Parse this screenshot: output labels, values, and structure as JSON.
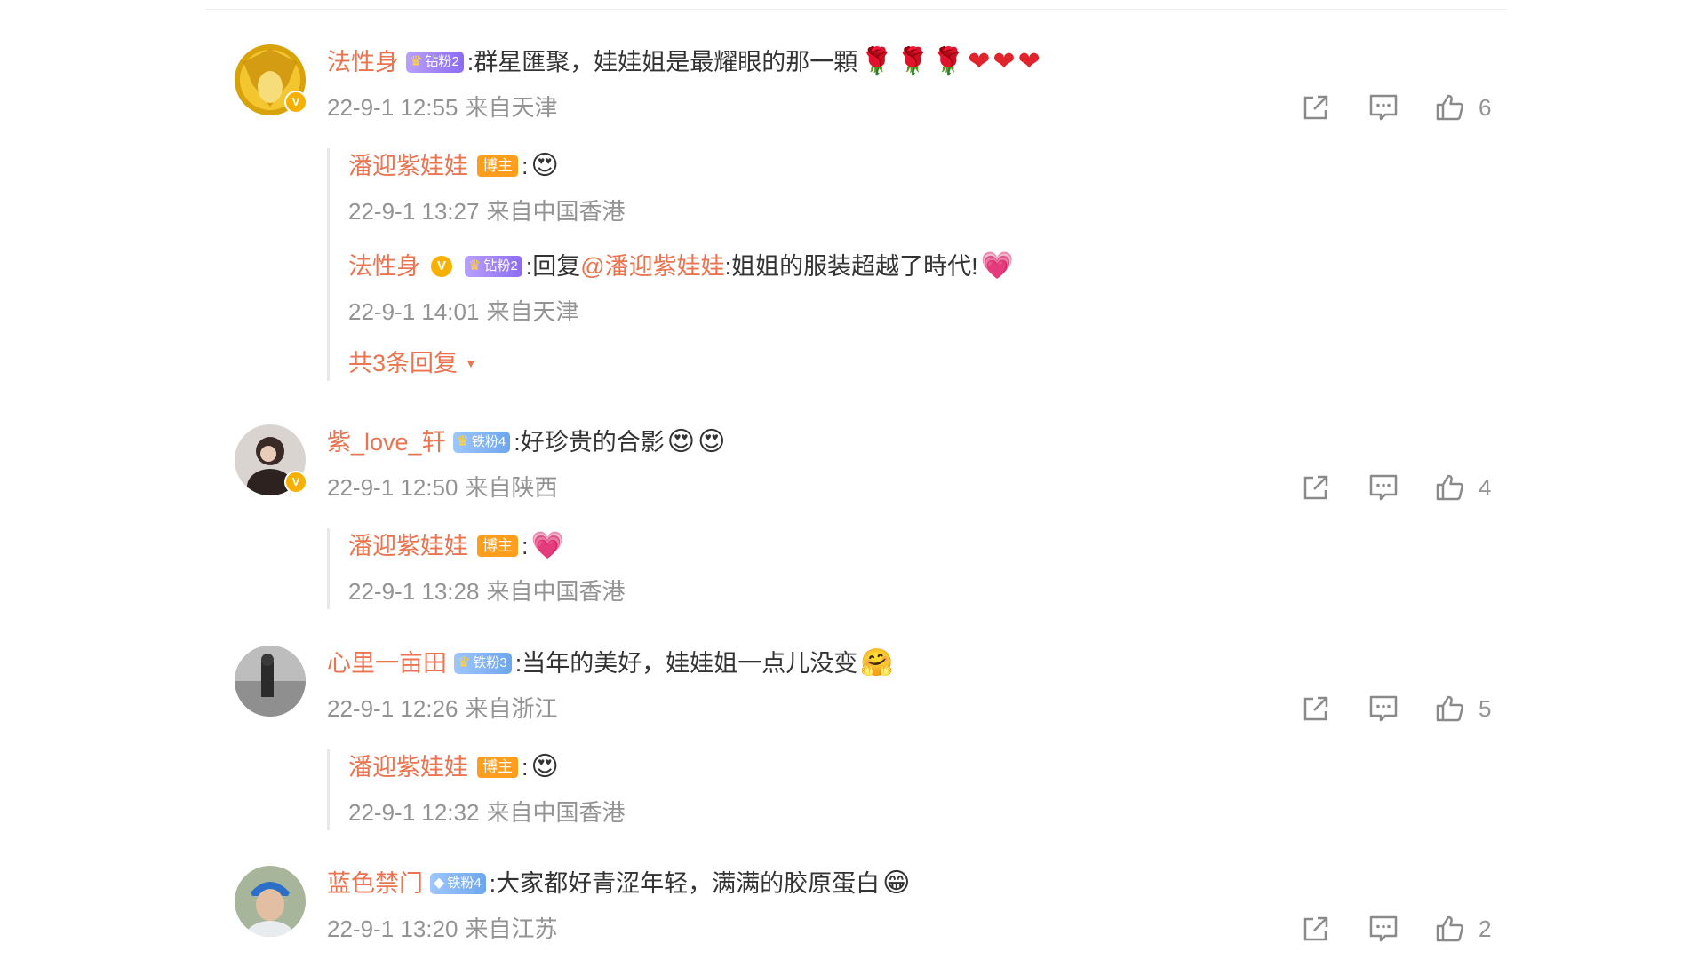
{
  "colors": {
    "accent": "#eb7350",
    "meta": "#939393",
    "text": "#333333",
    "verified": "#f7b000",
    "blogger_badge": "#ff9d1c"
  },
  "comments": [
    {
      "user": "法性身",
      "fan_badge": "钻粉2",
      "text": ":群星匯聚，娃娃姐是最耀眼的那一顆",
      "emojis": [
        "🌹",
        "🌹",
        "🌹",
        "❤",
        "❤",
        "❤"
      ],
      "time": "22-9-1 12:55",
      "location": "来自天津",
      "likes": "6",
      "replies": [
        {
          "user": "潘迎紫娃娃",
          "badge": "博主",
          "text": ":",
          "emoji": "😍",
          "time": "22-9-1 13:27",
          "location": "来自中国香港"
        },
        {
          "user": "法性身",
          "verified": "V",
          "badge": "钻粉2",
          "text_prefix": ":回复",
          "mention": "@潘迎紫娃娃",
          "text": ":姐姐的服装超越了時代!",
          "emoji": "💗",
          "time": "22-9-1 14:01",
          "location": "来自天津"
        }
      ],
      "more_replies": "共3条回复"
    },
    {
      "user": "紫_love_轩",
      "fan_badge": "铁粉4",
      "text": ":好珍贵的合影",
      "emojis": [
        "😍",
        "😍"
      ],
      "time": "22-9-1 12:50",
      "location": "来自陕西",
      "likes": "4",
      "replies": [
        {
          "user": "潘迎紫娃娃",
          "badge": "博主",
          "text": ":",
          "emoji": "💗",
          "time": "22-9-1 13:28",
          "location": "来自中国香港"
        }
      ]
    },
    {
      "user": "心里一亩田",
      "fan_badge": "铁粉3",
      "text": ":当年的美好，娃娃姐一点儿没变",
      "emojis": [
        "🤗"
      ],
      "time": "22-9-1 12:26",
      "location": "来自浙江",
      "likes": "5",
      "replies": [
        {
          "user": "潘迎紫娃娃",
          "badge": "博主",
          "text": ":",
          "emoji": "😍",
          "time": "22-9-1 12:32",
          "location": "来自中国香港"
        }
      ]
    },
    {
      "user": "蓝色禁门",
      "fan_badge": "铁粉4",
      "text": ":大家都好青涩年轻，满满的胶原蛋白",
      "emojis": [
        "😁"
      ],
      "time": "22-9-1 13:20",
      "location": "来自江苏",
      "likes": "2",
      "replies": []
    }
  ],
  "icons": {
    "share": "share-icon",
    "comment": "comment-icon",
    "like": "thumbs-up-icon",
    "crown": "crown-icon",
    "verified": "verified-icon"
  }
}
